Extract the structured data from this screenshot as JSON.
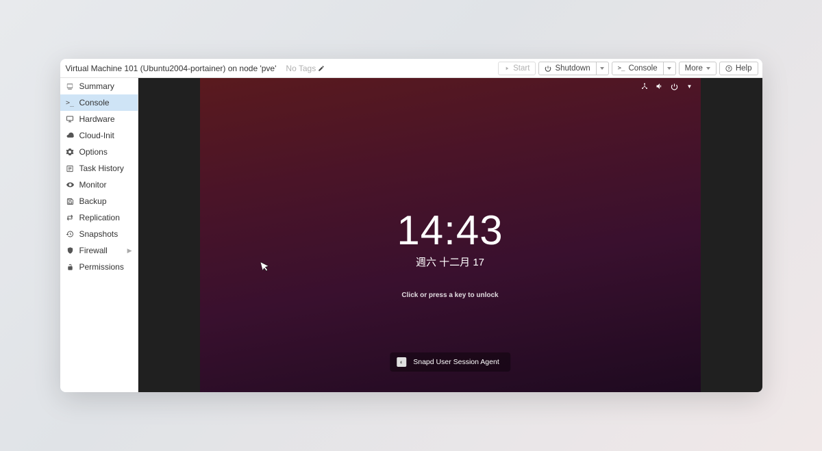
{
  "header": {
    "title": "Virtual Machine 101 (Ubuntu2004-portainer) on node 'pve'",
    "tags_label": "No Tags",
    "start_label": "Start",
    "shutdown_label": "Shutdown",
    "console_label": "Console",
    "more_label": "More",
    "help_label": "Help"
  },
  "sidebar": {
    "items": [
      {
        "label": "Summary"
      },
      {
        "label": "Console"
      },
      {
        "label": "Hardware"
      },
      {
        "label": "Cloud-Init"
      },
      {
        "label": "Options"
      },
      {
        "label": "Task History"
      },
      {
        "label": "Monitor"
      },
      {
        "label": "Backup"
      },
      {
        "label": "Replication"
      },
      {
        "label": "Snapshots"
      },
      {
        "label": "Firewall"
      },
      {
        "label": "Permissions"
      }
    ]
  },
  "vm": {
    "time": "14:43",
    "date": "週六 十二月 17",
    "unlock_hint": "Click or press a key to unlock",
    "notification": "Snapd User Session Agent"
  }
}
